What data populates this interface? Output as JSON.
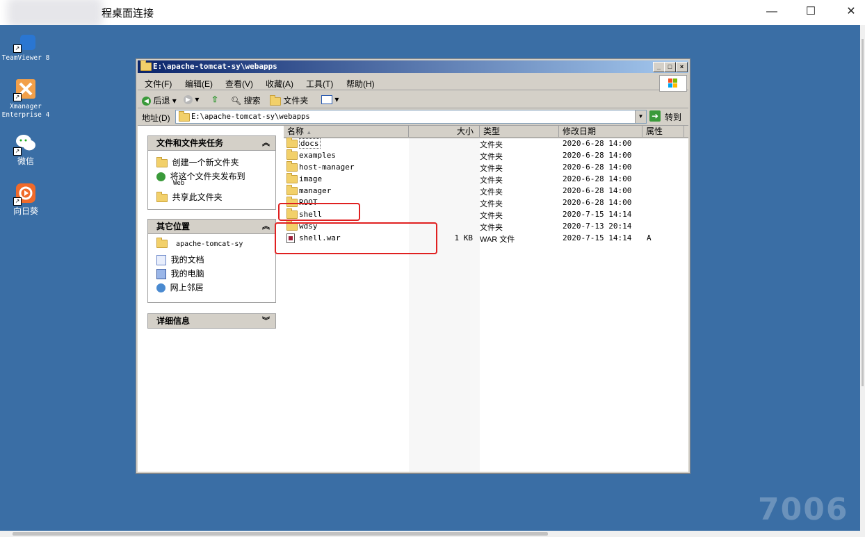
{
  "rdp": {
    "title": "远程桌面连接",
    "title_visible": "程桌面连接",
    "controls": {
      "minimize": "—",
      "maximize": "☐",
      "close": "✕"
    }
  },
  "desktop_icons": [
    {
      "label": "TeamViewer 8",
      "icon": "teamviewer-icon"
    },
    {
      "label": "Xmanager Enterprise 4",
      "icon": "xmanager-icon"
    },
    {
      "label": "微信",
      "icon": "wechat-icon"
    },
    {
      "label": "向日葵",
      "icon": "sunflower-icon"
    }
  ],
  "explorer": {
    "title": "E:\\apache-tomcat-sy\\webapps",
    "menu": [
      "文件(F)",
      "编辑(E)",
      "查看(V)",
      "收藏(A)",
      "工具(T)",
      "帮助(H)"
    ],
    "toolbar": {
      "back": "后退",
      "search": "搜索",
      "folders": "文件夹"
    },
    "address": {
      "label": "地址(D)",
      "value": "E:\\apache-tomcat-sy\\webapps",
      "go": "转到"
    },
    "tasks_panel": {
      "title": "文件和文件夹任务",
      "items": [
        "创建一个新文件夹",
        "将这个文件夹发布到",
        "Web",
        "共享此文件夹"
      ]
    },
    "places_panel": {
      "title": "其它位置",
      "items": [
        "apache-tomcat-sy",
        "我的文档",
        "我的电脑",
        "网上邻居"
      ]
    },
    "details_panel": {
      "title": "详细信息"
    },
    "columns": [
      "名称",
      "大小",
      "类型",
      "修改日期",
      "属性"
    ],
    "files": [
      {
        "name": "docs",
        "size": "",
        "type": "文件夹",
        "date": "2020-6-28 14:00",
        "attr": ""
      },
      {
        "name": "examples",
        "size": "",
        "type": "文件夹",
        "date": "2020-6-28 14:00",
        "attr": ""
      },
      {
        "name": "host-manager",
        "size": "",
        "type": "文件夹",
        "date": "2020-6-28 14:00",
        "attr": ""
      },
      {
        "name": "image",
        "size": "",
        "type": "文件夹",
        "date": "2020-6-28 14:00",
        "attr": ""
      },
      {
        "name": "manager",
        "size": "",
        "type": "文件夹",
        "date": "2020-6-28 14:00",
        "attr": ""
      },
      {
        "name": "ROOT",
        "size": "",
        "type": "文件夹",
        "date": "2020-6-28 14:00",
        "attr": ""
      },
      {
        "name": "shell",
        "size": "",
        "type": "文件夹",
        "date": "2020-7-15 14:14",
        "attr": ""
      },
      {
        "name": "wdsy",
        "size": "",
        "type": "文件夹",
        "date": "2020-7-13 20:14",
        "attr": ""
      },
      {
        "name": "shell.war",
        "size": "1 KB",
        "type": "WAR 文件",
        "date": "2020-7-15 14:14",
        "attr": "A"
      }
    ]
  },
  "watermark": "7006"
}
